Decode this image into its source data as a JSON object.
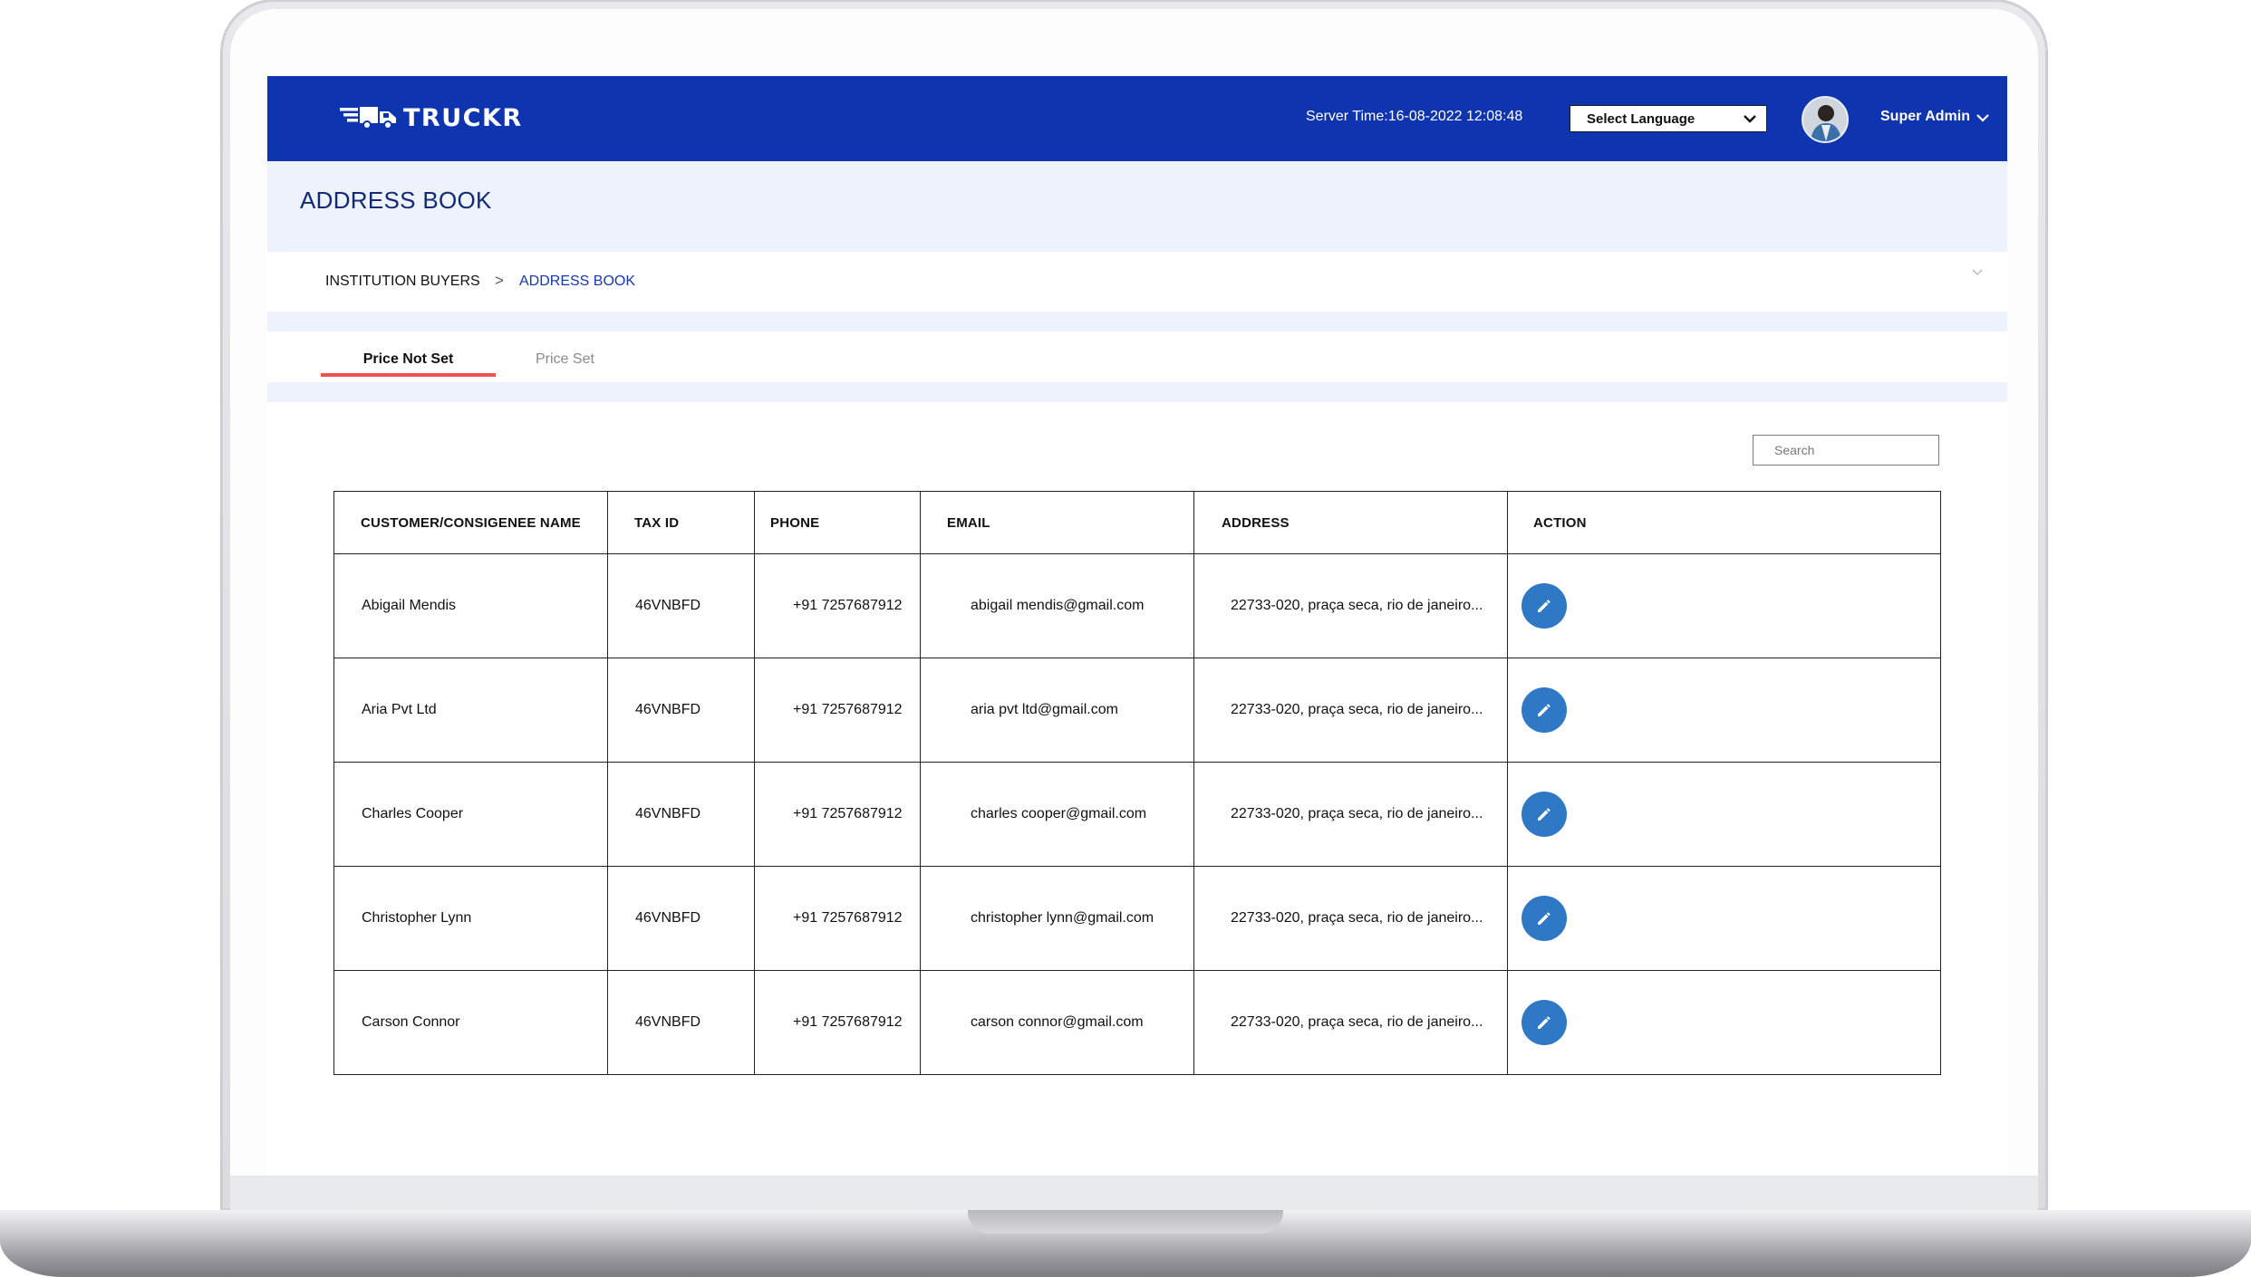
{
  "brand": {
    "name": "TRUCKR"
  },
  "header": {
    "server_time": "Server Time:16-08-2022  12:08:48",
    "language_select": "Select Language",
    "user_name": "Super Admin"
  },
  "page": {
    "title": "ADDRESS BOOK"
  },
  "breadcrumb": {
    "parent": "INSTITUTION BUYERS",
    "separator": ">",
    "current": "ADDRESS BOOK"
  },
  "tabs": [
    {
      "label": "Price Not Set",
      "active": true
    },
    {
      "label": "Price Set",
      "active": false
    }
  ],
  "search": {
    "placeholder": "Search"
  },
  "table": {
    "columns": [
      "CUSTOMER/CONSIGENEE NAME",
      "TAX ID",
      "PHONE",
      "EMAIL",
      "ADDRESS",
      "ACTION"
    ],
    "rows": [
      {
        "name": "Abigail Mendis",
        "tax_id": "46VNBFD",
        "phone": "+91 7257687912",
        "email": "abigail mendis@gmail.com",
        "address": "22733-020, praça seca, rio de janeiro..."
      },
      {
        "name": "Aria Pvt Ltd",
        "tax_id": "46VNBFD",
        "phone": "+91 7257687912",
        "email": "aria pvt ltd@gmail.com",
        "address": "22733-020, praça seca, rio de janeiro..."
      },
      {
        "name": "Charles Cooper",
        "tax_id": "46VNBFD",
        "phone": "+91 7257687912",
        "email": "charles cooper@gmail.com",
        "address": "22733-020, praça seca, rio de janeiro..."
      },
      {
        "name": "Christopher Lynn",
        "tax_id": "46VNBFD",
        "phone": "+91 7257687912",
        "email": "christopher lynn@gmail.com",
        "address": "22733-020, praça seca, rio de janeiro..."
      },
      {
        "name": "Carson Connor",
        "tax_id": "46VNBFD",
        "phone": "+91 7257687912",
        "email": "carson connor@gmail.com",
        "address": "22733-020, praça seca, rio de janeiro..."
      }
    ]
  },
  "colors": {
    "header_bg": "#0f34b0",
    "page_head_bg": "#eef2fc",
    "title_color": "#112a73",
    "breadcrumb_active": "#1637b5",
    "tab_underline": "#f0504f",
    "action_button": "#2f78c5"
  },
  "icons": {
    "logo": "truck-logo-icon",
    "language_dropdown": "chevron-down-icon",
    "user_menu": "chevron-down-icon",
    "breadcrumb_collapse": "chevron-down-icon",
    "row_action": "pencil-icon"
  }
}
